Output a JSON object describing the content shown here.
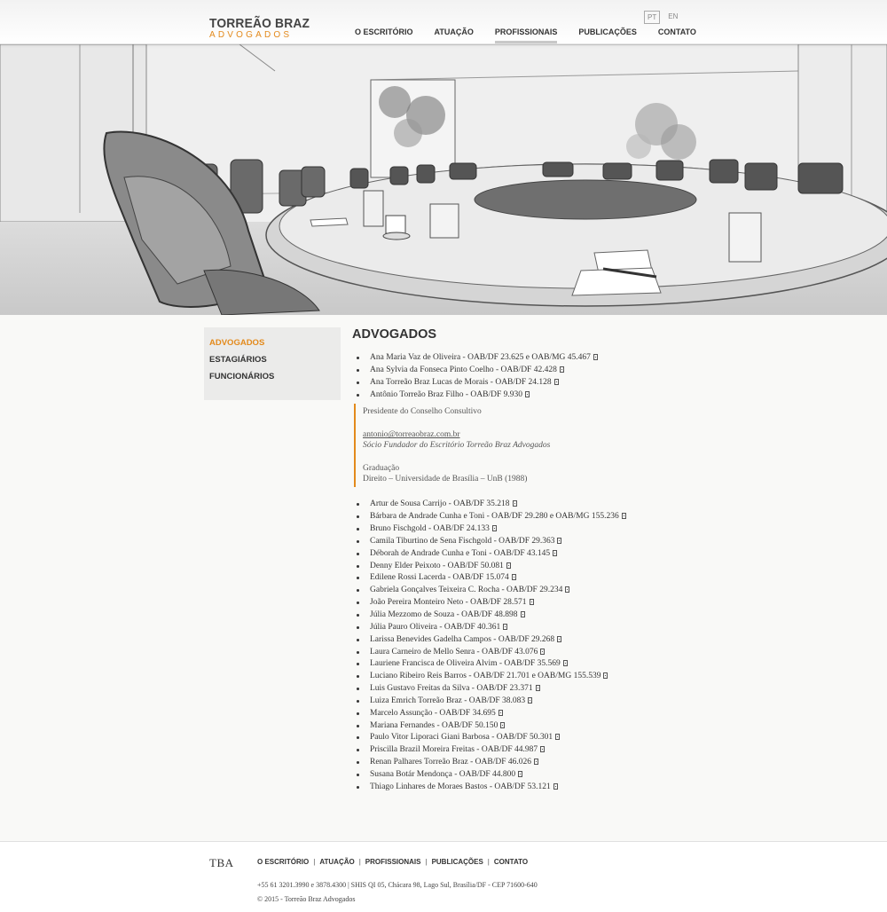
{
  "header": {
    "logo_top": "TORREÃO BRAZ",
    "logo_bottom": "ADVOGADOS",
    "lang": [
      "PT",
      "EN"
    ],
    "nav": [
      "O ESCRITÓRIO",
      "ATUAÇÃO",
      "PROFISSIONAIS",
      "PUBLICAÇÕES",
      "CONTATO"
    ]
  },
  "sidebar": {
    "items": [
      "ADVOGADOS",
      "ESTAGIÁRIOS",
      "FUNCIONÁRIOS"
    ]
  },
  "main": {
    "title": "ADVOGADOS",
    "lawyers_top": [
      "Ana Maria Vaz de Oliveira - OAB/DF 23.625 e OAB/MG 45.467",
      "Ana Sylvia da Fonseca Pinto Coelho - OAB/DF 42.428",
      "Ana Torreão Braz Lucas de Morais - OAB/DF 24.128",
      "Antônio Torreão Braz Filho - OAB/DF 9.930"
    ],
    "detail": {
      "role": "Presidente do Conselho Consultivo",
      "email": "antonio@torreaobraz.com.br",
      "founder": "Sócio Fundador do Escritório Torreão Braz Advogados",
      "education_label": "Graduação",
      "education": "Direito – Universidade de Brasília – UnB (1988)"
    },
    "lawyers_bottom": [
      "Artur de Sousa Carrijo - OAB/DF 35.218",
      "Bárbara de Andrade Cunha e Toni - OAB/DF 29.280 e OAB/MG 155.236",
      "Bruno Fischgold - OAB/DF 24.133",
      "Camila Tiburtino de Sena Fischgold - OAB/DF 29.363",
      "Déborah de Andrade Cunha e Toni - OAB/DF 43.145",
      "Denny Elder Peixoto - OAB/DF 50.081",
      "Edilene Rossi Lacerda - OAB/DF 15.074",
      "Gabriela Gonçalves Teixeira C. Rocha - OAB/DF 29.234",
      "João Pereira Monteiro Neto - OAB/DF 28.571",
      "Júlia Mezzomo de Souza - OAB/DF 48.898",
      "Júlia Pauro Oliveira - OAB/DF 40.361",
      "Larissa Benevides Gadelha Campos - OAB/DF 29.268",
      "Laura Carneiro de Mello Senra - OAB/DF 43.076",
      "Lauriene Francisca de Oliveira Alvim - OAB/DF 35.569",
      "Luciano Ribeiro Reis Barros - OAB/DF 21.701 e OAB/MG 155.539",
      "Luis Gustavo Freitas da Silva - OAB/DF 23.371",
      "Luiza Emrich Torreão Braz - OAB/DF 38.083",
      "Marcelo Assunção - OAB/DF 34.695",
      "Mariana Fernandes - OAB/DF 50.150",
      "Paulo Vitor Liporaci Giani Barbosa - OAB/DF 50.301",
      "Priscilla Brazil Moreira Freitas - OAB/DF 44.987",
      "Renan Palhares Torreão Braz - OAB/DF 46.026",
      "Susana Botár Mendonça - OAB/DF 44.800",
      "Thiago Linhares de Moraes Bastos - OAB/DF 53.121"
    ]
  },
  "footer": {
    "logo": "TBA",
    "nav": [
      "O ESCRITÓRIO",
      "ATUAÇÃO",
      "PROFISSIONAIS",
      "PUBLICAÇÕES",
      "CONTATO"
    ],
    "contact": "+55 61 3201.3990 e 3878.4300 | SHIS QI 05, Chácara 98, Lago Sul, Brasília/DF - CEP 71600-640",
    "copyright": "© 2015 - Torreão Braz Advogados"
  },
  "colors": {
    "accent": "#e38a1c",
    "text": "#333333",
    "sidebar_bg": "#ebebea"
  },
  "icons": {
    "document": "doc-icon"
  }
}
